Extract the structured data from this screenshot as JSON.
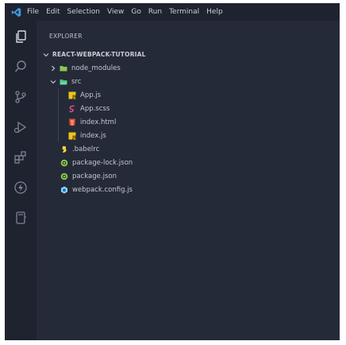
{
  "menu": {
    "items": [
      "File",
      "Edit",
      "Selection",
      "View",
      "Go",
      "Run",
      "Terminal",
      "Help"
    ]
  },
  "activitybar": {
    "icons": [
      "explorer-icon",
      "search-icon",
      "source-control-icon",
      "run-debug-icon",
      "extensions-icon",
      "lightning-icon",
      "notebook-icon"
    ]
  },
  "explorer": {
    "title": "EXPLORER",
    "root": "REACT-WEBPACK-TUTORIAL",
    "node_modules": "node_modules",
    "src": "src",
    "files_src": [
      "App.js",
      "App.scss",
      "index.html",
      "index.js"
    ],
    "files_root": [
      ".babelrc",
      "package-lock.json",
      "package.json",
      "webpack.config.js"
    ]
  },
  "colors": {
    "window_bg": "#252a38",
    "activitybar_bg": "#1f2330",
    "js_yellow": "#f0c419",
    "sass_pink": "#e0508f",
    "html_orange": "#e44d26",
    "babel_yellow": "#f5d53c",
    "node_green": "#8cc84b",
    "webpack_blue": "#8ed6fb"
  }
}
